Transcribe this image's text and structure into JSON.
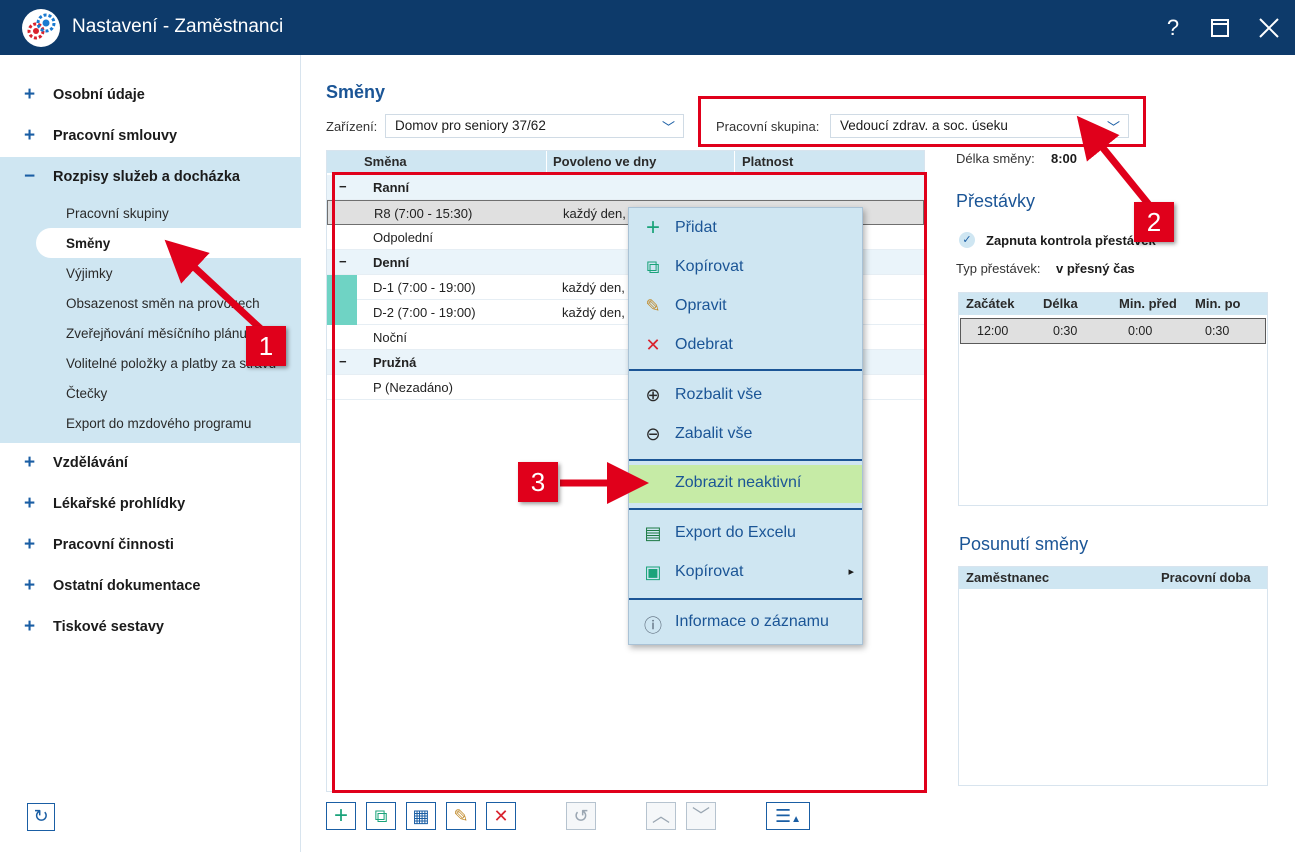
{
  "window": {
    "title": "Nastavení - Zaměstnanci",
    "help": "?",
    "maximize": "☐",
    "close": "✕"
  },
  "sidebar": {
    "items": [
      {
        "label": "Osobní údaje",
        "icon": "+"
      },
      {
        "label": "Pracovní smlouvy",
        "icon": "+"
      },
      {
        "label": "Rozpisy služeb a docházka",
        "icon": "−"
      },
      {
        "label": "Vzdělávání",
        "icon": "+"
      },
      {
        "label": "Lékařské prohlídky",
        "icon": "+"
      },
      {
        "label": "Pracovní činnosti",
        "icon": "+"
      },
      {
        "label": "Ostatní dokumentace",
        "icon": "+"
      },
      {
        "label": "Tiskové sestavy",
        "icon": "+"
      }
    ],
    "subitems": [
      "Pracovní skupiny",
      "Směny",
      "Výjimky",
      "Obsazenost směn na provozech",
      "Zveřejňování měsíčního plánu",
      "Volitelné položky a platby za stravu",
      "Čtečky",
      "Export do mzdového programu"
    ]
  },
  "main": {
    "title": "Směny",
    "facility_label": "Zařízení:",
    "facility_value": "Domov pro seniory 37/62",
    "group_label": "Pracovní skupina:",
    "group_value": "Vedoucí zdrav. a soc. úseku",
    "columns": [
      "Směna",
      "Povoleno ve dny",
      "Platnost"
    ],
    "rows": [
      {
        "type": "group",
        "mark": "−",
        "name": "Ranní"
      },
      {
        "type": "row",
        "name": "R8 (7:00 - 15:30)",
        "days": "každý den,",
        "selected": true
      },
      {
        "type": "row",
        "name": "Odpolední",
        "days": ""
      },
      {
        "type": "group",
        "mark": "−",
        "name": "Denní"
      },
      {
        "type": "row",
        "name": "D-1 (7:00 - 19:00)",
        "days": "každý den,",
        "stripe": true
      },
      {
        "type": "row",
        "name": "D-2 (7:00 - 19:00)",
        "days": "každý den,",
        "stripe": true
      },
      {
        "type": "row",
        "name": "Noční",
        "days": ""
      },
      {
        "type": "group",
        "mark": "−",
        "name": "Pružná"
      },
      {
        "type": "row",
        "name": "P (Nezadáno)",
        "days": ""
      }
    ]
  },
  "context_menu": {
    "items": [
      {
        "label": "Přidat",
        "icon": "plus-icon",
        "glyph": "+",
        "color": "#1aa37a"
      },
      {
        "label": "Kopírovat",
        "icon": "copy-icon",
        "glyph": "⧉",
        "color": "#1aa37a"
      },
      {
        "label": "Opravit",
        "icon": "pencil-icon",
        "glyph": "✎",
        "color": "#c08a2a"
      },
      {
        "label": "Odebrat",
        "icon": "delete-icon",
        "glyph": "✕",
        "color": "#d9232e"
      },
      {
        "label": "Rozbalit vše",
        "icon": "expand-all-icon",
        "glyph": "⊕",
        "color": "#2a2a2a"
      },
      {
        "label": "Zabalit vše",
        "icon": "collapse-all-icon",
        "glyph": "⊖",
        "color": "#2a2a2a"
      },
      {
        "label": "Zobrazit neaktivní",
        "icon": "",
        "glyph": "",
        "color": "#1b5596"
      },
      {
        "label": "Export do Excelu",
        "icon": "excel-icon",
        "glyph": "▤",
        "color": "#1d7a45"
      },
      {
        "label": "Kopírovat",
        "icon": "clipboard-icon",
        "glyph": "▣",
        "color": "#1aa37a"
      },
      {
        "label": "Informace o záznamu",
        "icon": "info-icon",
        "glyph": "ⓘ",
        "color": "#5a6a7a"
      }
    ],
    "submenu_arrow": "▸"
  },
  "right_panel": {
    "shift_length_label": "Délka směny:",
    "shift_length_value": "8:00",
    "breaks_title": "Přestávky",
    "breaks_check_label": "Zapnuta kontrola přestávek",
    "breaks_type_label": "Typ přestávek:",
    "breaks_type_value": "v přesný čas",
    "breaks_columns": [
      "Začátek",
      "Délka",
      "Min. před",
      "Min. po"
    ],
    "breaks_row": [
      "12:00",
      "0:30",
      "0:00",
      "0:30"
    ],
    "shift_move_title": "Posunutí směny",
    "shift_move_columns": [
      "Zaměstnanec",
      "Pracovní doba"
    ]
  },
  "annotations": [
    "1",
    "2",
    "3"
  ],
  "colors": {
    "titlebar": "#0d3a6a",
    "accent": "#1b5596",
    "highlight": "#c6eba6",
    "annotation": "#e0001b"
  }
}
